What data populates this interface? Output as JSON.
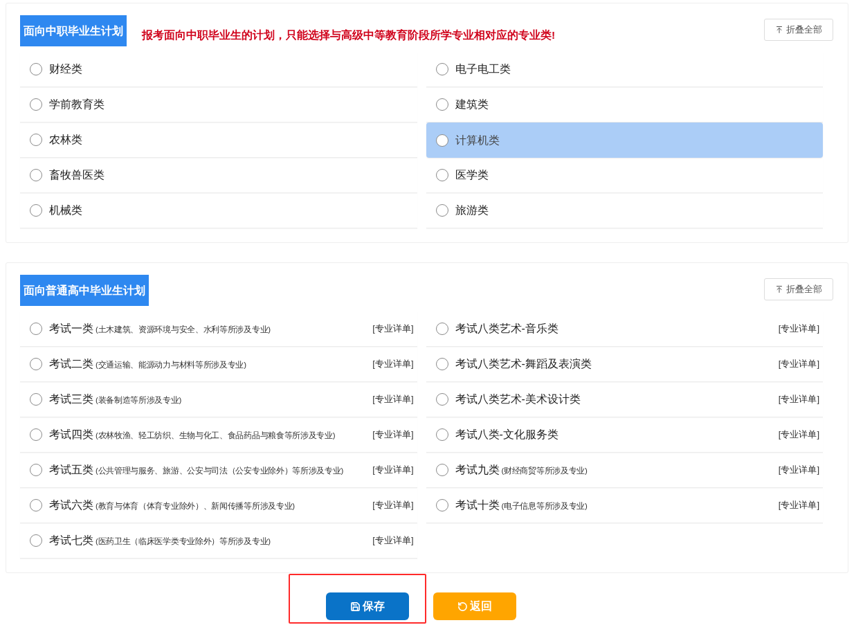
{
  "sections": [
    {
      "title": "面向中职毕业生计划",
      "notice": "报考面向中职毕业生的计划，只能选择与高级中等教育阶段所学专业相对应的专业类!",
      "collapse_button": "折叠全部",
      "options": [
        {
          "name": "财经类",
          "checked": false,
          "highlighted": false
        },
        {
          "name": "电子电工类",
          "checked": false,
          "highlighted": false
        },
        {
          "name": "学前教育类",
          "checked": false,
          "highlighted": false
        },
        {
          "name": "建筑类",
          "checked": false,
          "highlighted": false
        },
        {
          "name": "农林类",
          "checked": false,
          "highlighted": false
        },
        {
          "name": "计算机类",
          "checked": false,
          "highlighted": true
        },
        {
          "name": "畜牧兽医类",
          "checked": false,
          "highlighted": false
        },
        {
          "name": "医学类",
          "checked": false,
          "highlighted": false
        },
        {
          "name": "机械类",
          "checked": false,
          "highlighted": false
        },
        {
          "name": "旅游类",
          "checked": false,
          "highlighted": false
        }
      ]
    },
    {
      "title": "面向普通高中毕业生计划",
      "collapse_button": "折叠全部",
      "options": [
        {
          "name": "考试一类",
          "note": "(土木建筑、资源环境与安全、水利等所涉及专业)",
          "link": "[专业详单]",
          "checked": false,
          "highlighted": false
        },
        {
          "name": "考试八类艺术-音乐类",
          "link": "[专业详单]",
          "checked": false,
          "highlighted": false
        },
        {
          "name": "考试二类",
          "note": "(交通运输、能源动力与材料等所涉及专业)",
          "link": "[专业详单]",
          "checked": false,
          "highlighted": false
        },
        {
          "name": "考试八类艺术-舞蹈及表演类",
          "link": "[专业详单]",
          "checked": false,
          "highlighted": false
        },
        {
          "name": "考试三类",
          "note": "(装备制造等所涉及专业)",
          "link": "[专业详单]",
          "checked": false,
          "highlighted": false
        },
        {
          "name": "考试八类艺术-美术设计类",
          "link": "[专业详单]",
          "checked": false,
          "highlighted": false
        },
        {
          "name": "考试四类",
          "note": "(农林牧渔、轻工纺织、生物与化工、食品药品与粮食等所涉及专业)",
          "link": "[专业详单]",
          "checked": false,
          "highlighted": false
        },
        {
          "name": "考试八类-文化服务类",
          "link": "[专业详单]",
          "checked": false,
          "highlighted": false
        },
        {
          "name": "考试五类",
          "note": "(公共管理与服务、旅游、公安与司法（公安专业除外）等所涉及专业)",
          "link": "[专业详单]",
          "checked": false,
          "highlighted": false
        },
        {
          "name": "考试九类",
          "note": "(财经商贸等所涉及专业)",
          "link": "[专业详单]",
          "checked": false,
          "highlighted": false
        },
        {
          "name": "考试六类",
          "note": "(教育与体育（体育专业除外）、新闻传播等所涉及专业)",
          "link": "[专业详单]",
          "checked": false,
          "highlighted": false
        },
        {
          "name": "考试十类",
          "note": "(电子信息等所涉及专业)",
          "link": "[专业详单]",
          "checked": false,
          "highlighted": false
        },
        {
          "name": "考试七类",
          "note": "(医药卫生（临床医学类专业除外）等所涉及专业)",
          "link": "[专业详单]",
          "checked": false,
          "highlighted": false
        }
      ]
    }
  ],
  "buttons": [
    {
      "kind": "save",
      "label": "保存"
    },
    {
      "kind": "back",
      "label": "返回"
    }
  ]
}
